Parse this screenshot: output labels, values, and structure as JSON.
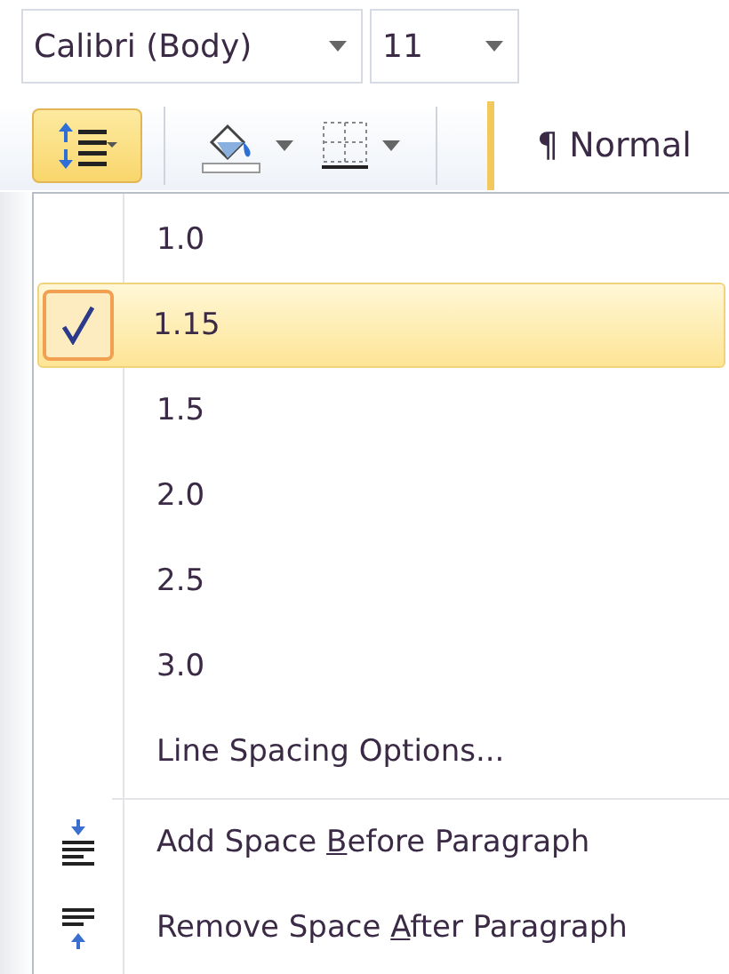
{
  "font_field": {
    "value": "Calibri (Body)"
  },
  "size_field": {
    "value": "11"
  },
  "style_gallery": {
    "label": "¶ Normal"
  },
  "line_spacing_button": {
    "selected": true
  },
  "menu": {
    "items": [
      {
        "kind": "spacing",
        "label": "1.0",
        "selected": false
      },
      {
        "kind": "spacing",
        "label": "1.15",
        "selected": true
      },
      {
        "kind": "spacing",
        "label": "1.5",
        "selected": false
      },
      {
        "kind": "spacing",
        "label": "2.0",
        "selected": false
      },
      {
        "kind": "spacing",
        "label": "2.5",
        "selected": false
      },
      {
        "kind": "spacing",
        "label": "3.0",
        "selected": false
      },
      {
        "kind": "options",
        "label": "Line Spacing Options..."
      },
      {
        "kind": "add_before",
        "parts": [
          "Add Space ",
          "B",
          "efore Paragraph"
        ]
      },
      {
        "kind": "remove_after",
        "parts": [
          "Remove Space ",
          "A",
          "fter Paragraph"
        ]
      }
    ]
  }
}
